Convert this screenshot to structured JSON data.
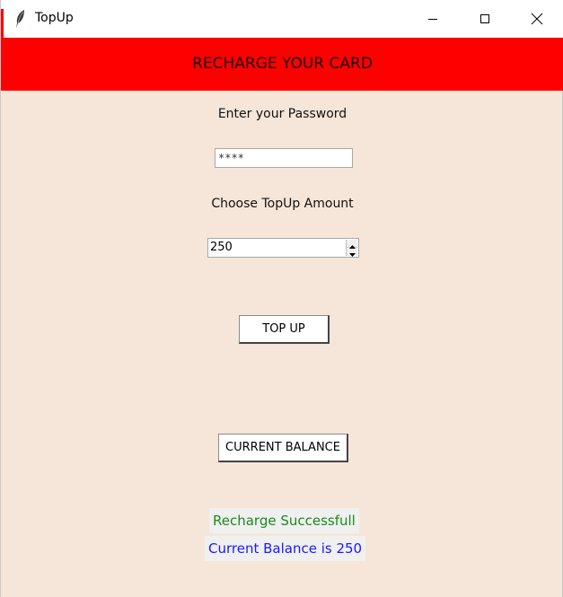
{
  "window": {
    "title": "TopUp",
    "icon": "feather-icon"
  },
  "header": {
    "title": "RECHARGE YOUR CARD"
  },
  "password": {
    "label": "Enter your Password",
    "value": "****"
  },
  "amount": {
    "label": "Choose TopUp Amount",
    "value": "250"
  },
  "buttons": {
    "topup_label": "TOP UP",
    "balance_label": "CURRENT BALANCE"
  },
  "messages": {
    "status": "Recharge Successfull",
    "balance": "Current Balance is 250"
  },
  "colors": {
    "header_bg": "#ff0000",
    "window_bg": "#f6e6d9",
    "status_text": "#1a8a1a",
    "balance_text": "#1a1aff"
  }
}
